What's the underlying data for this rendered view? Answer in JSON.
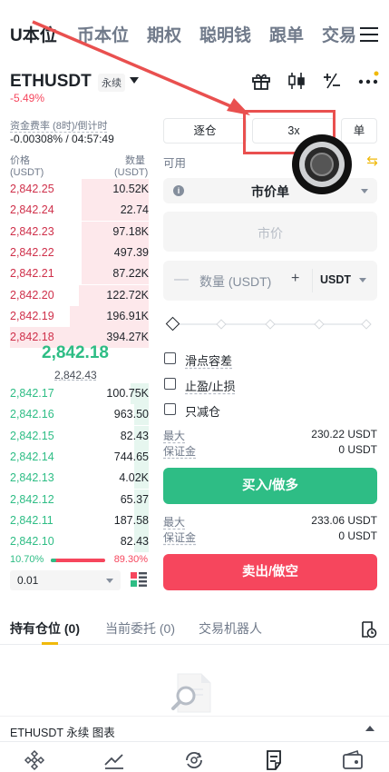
{
  "top_tabs": [
    {
      "label": "U本位",
      "active": true
    },
    {
      "label": "币本位",
      "active": false
    },
    {
      "label": "期权",
      "active": false
    },
    {
      "label": "聪明钱",
      "active": false
    },
    {
      "label": "跟单",
      "active": false
    },
    {
      "label": "交易",
      "active": false
    }
  ],
  "header": {
    "symbol": "ETHUSDT",
    "contract_type": "永续",
    "change": "-5.49%",
    "icons": [
      "gift-icon",
      "candlestick-icon",
      "plus-minus-icon",
      "more-icon"
    ]
  },
  "funding": {
    "label": "资金费率 (8时)/倒计时",
    "value": "-0.00308% / 04:57:49"
  },
  "orderbook": {
    "price_header": "价格",
    "price_unit": "(USDT)",
    "qty_header": "数量",
    "qty_unit": "(USDT)",
    "asks": [
      {
        "price": "2,842.25",
        "qty": "10.52K",
        "depth": 0.45
      },
      {
        "price": "2,842.24",
        "qty": "22.74",
        "depth": 0.45
      },
      {
        "price": "2,842.23",
        "qty": "97.18K",
        "depth": 0.45
      },
      {
        "price": "2,842.22",
        "qty": "497.39",
        "depth": 0.45
      },
      {
        "price": "2,842.21",
        "qty": "87.22K",
        "depth": 0.45
      },
      {
        "price": "2,842.20",
        "qty": "122.72K",
        "depth": 0.47
      },
      {
        "price": "2,842.19",
        "qty": "196.91K",
        "depth": 0.53
      },
      {
        "price": "2,842.18",
        "qty": "394.27K",
        "depth": 0.93
      }
    ],
    "last_price": "2,842.18",
    "mark_price": "2,842.43",
    "bids": [
      {
        "price": "2,842.17",
        "qty": "100.75K",
        "depth": 0.12
      },
      {
        "price": "2,842.16",
        "qty": "963.50",
        "depth": 0.1
      },
      {
        "price": "2,842.15",
        "qty": "82.43",
        "depth": 0.1
      },
      {
        "price": "2,842.14",
        "qty": "744.65",
        "depth": 0.1
      },
      {
        "price": "2,842.13",
        "qty": "4.02K",
        "depth": 0.1
      },
      {
        "price": "2,842.12",
        "qty": "65.37",
        "depth": 0.1
      },
      {
        "price": "2,842.11",
        "qty": "187.58",
        "depth": 0.1
      },
      {
        "price": "2,842.10",
        "qty": "82.43",
        "depth": 0.1
      }
    ],
    "buy_ratio": "10.70%",
    "sell_ratio": "89.30%",
    "buy_ratio_value": 0.107,
    "precision": "0.01"
  },
  "form": {
    "margin_mode": "逐仓",
    "leverage": "3x",
    "position_mode": "单",
    "available_label": "可用",
    "order_type": "市价单",
    "market_price_placeholder": "市价",
    "qty_placeholder": "数量 (USDT)",
    "qty_unit": "USDT",
    "slider_levels": [
      0,
      25,
      50,
      75,
      100
    ],
    "checkboxes": [
      {
        "label": "滑点容差",
        "dashed": true
      },
      {
        "label": "止盈/止损",
        "dashed": true
      },
      {
        "label": "只减仓",
        "dashed": false
      }
    ],
    "buy": {
      "max_label": "最大",
      "max_value": "230.22 USDT",
      "margin_label": "保证金",
      "margin_value": "0 USDT",
      "button": "买入/做多"
    },
    "sell": {
      "max_label": "最大",
      "max_value": "233.06 USDT",
      "margin_label": "保证金",
      "margin_value": "0 USDT",
      "button": "卖出/做空"
    }
  },
  "bottom_tabs": [
    {
      "label": "持有仓位 (0)",
      "active": true
    },
    {
      "label": "当前委托 (0)",
      "active": false
    },
    {
      "label": "交易机器人",
      "active": false
    }
  ],
  "footer_bar": {
    "label": "ETHUSDT 永续 图表"
  },
  "nav": [
    "home-icon",
    "markets-icon",
    "trade-icon",
    "futures-icon",
    "wallet-icon"
  ],
  "colors": {
    "buy": "#2ebd85",
    "sell": "#f6465d",
    "accent": "#f0b90b",
    "annotation": "#e9504f"
  }
}
